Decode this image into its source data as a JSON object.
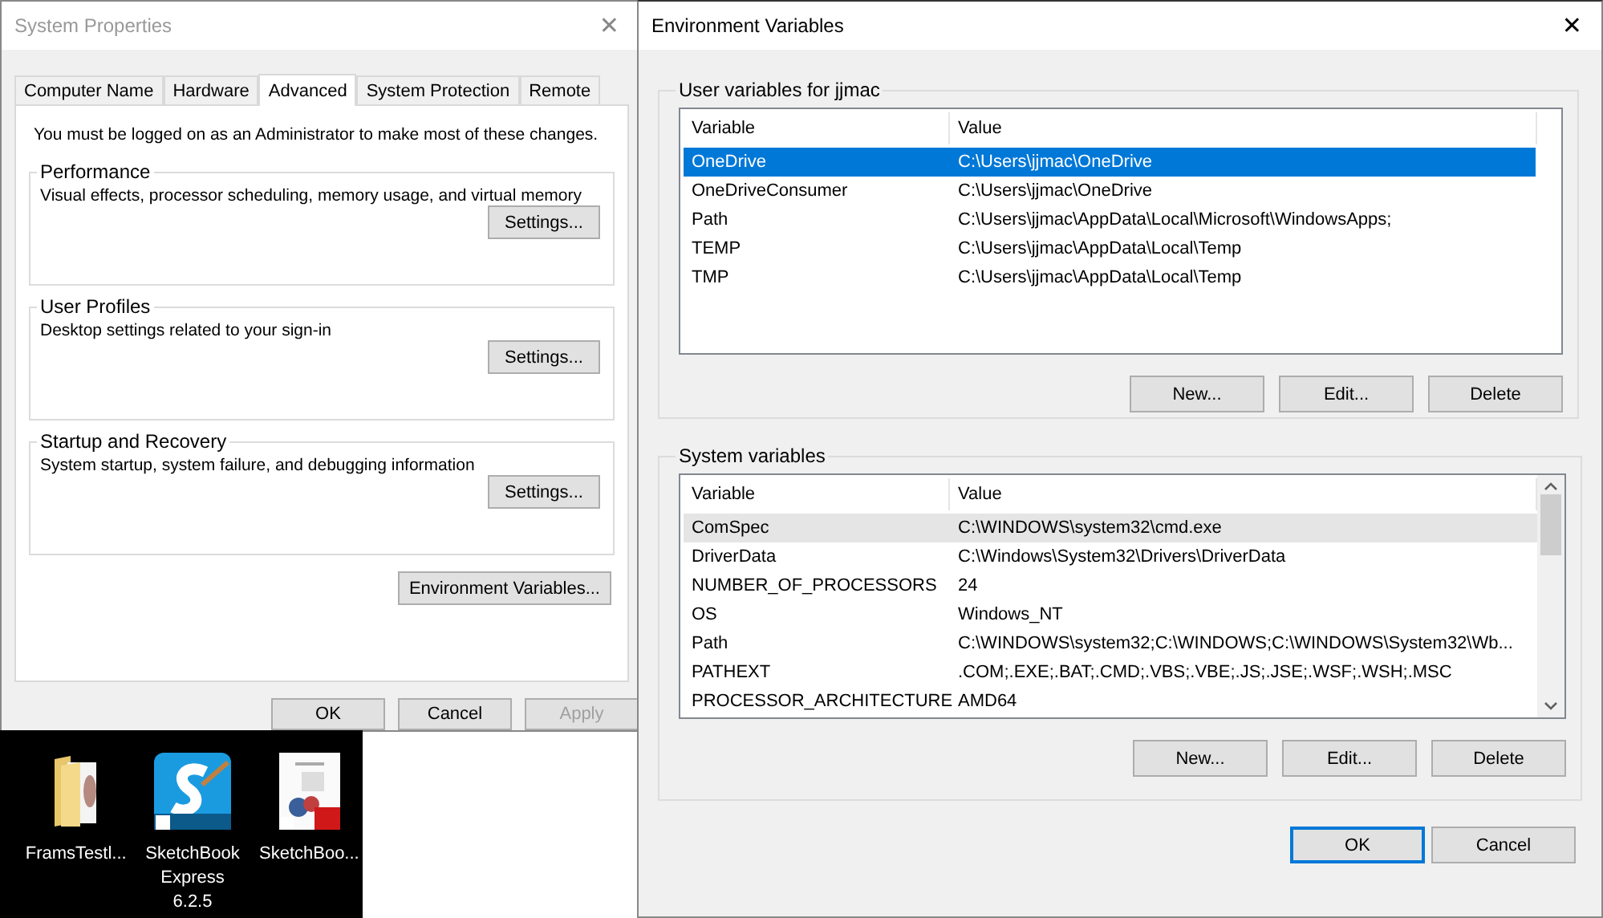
{
  "system_properties": {
    "title": "System Properties",
    "close": "✕",
    "tabs": [
      {
        "label": "Computer Name",
        "selected": false
      },
      {
        "label": "Hardware",
        "selected": false
      },
      {
        "label": "Advanced",
        "selected": true
      },
      {
        "label": "System Protection",
        "selected": false
      },
      {
        "label": "Remote",
        "selected": false
      }
    ],
    "notice": "You must be logged on as an Administrator to make most of these changes.",
    "groups": [
      {
        "title": "Performance",
        "description": "Visual effects, processor scheduling, memory usage, and virtual memory",
        "button": "Settings..."
      },
      {
        "title": "User Profiles",
        "description": "Desktop settings related to your sign-in",
        "button": "Settings..."
      },
      {
        "title": "Startup and Recovery",
        "description": "System startup, system failure, and debugging information",
        "button": "Settings..."
      }
    ],
    "env_button": "Environment Variables...",
    "buttons": [
      {
        "label": "OK",
        "disabled": false
      },
      {
        "label": "Cancel",
        "disabled": false
      },
      {
        "label": "Apply",
        "disabled": true
      }
    ]
  },
  "desktop": {
    "icons": [
      {
        "kind": "folder",
        "label": "FramsTestl..."
      },
      {
        "kind": "sketchbook",
        "label": "SketchBook Express 6.2.5"
      },
      {
        "kind": "pdf",
        "label": "SketchBoo..."
      }
    ]
  },
  "environment_variables": {
    "title": "Environment Variables",
    "close": "✕",
    "sections": [
      {
        "title": "User variables for jjmac",
        "focused": true,
        "scrollable": false,
        "columns": [
          "Variable",
          "Value"
        ],
        "rows": [
          {
            "variable": "OneDrive",
            "value": "C:\\Users\\jjmac\\OneDrive",
            "selected": true
          },
          {
            "variable": "OneDriveConsumer",
            "value": "C:\\Users\\jjmac\\OneDrive",
            "selected": false
          },
          {
            "variable": "Path",
            "value": "C:\\Users\\jjmac\\AppData\\Local\\Microsoft\\WindowsApps;",
            "selected": false
          },
          {
            "variable": "TEMP",
            "value": "C:\\Users\\jjmac\\AppData\\Local\\Temp",
            "selected": false
          },
          {
            "variable": "TMP",
            "value": "C:\\Users\\jjmac\\AppData\\Local\\Temp",
            "selected": false
          }
        ],
        "buttons": [
          "New...",
          "Edit...",
          "Delete"
        ]
      },
      {
        "title": "System variables",
        "focused": false,
        "scrollable": true,
        "columns": [
          "Variable",
          "Value"
        ],
        "rows": [
          {
            "variable": "ComSpec",
            "value": "C:\\WINDOWS\\system32\\cmd.exe",
            "selected": true
          },
          {
            "variable": "DriverData",
            "value": "C:\\Windows\\System32\\Drivers\\DriverData",
            "selected": false
          },
          {
            "variable": "NUMBER_OF_PROCESSORS",
            "value": "24",
            "selected": false
          },
          {
            "variable": "OS",
            "value": "Windows_NT",
            "selected": false
          },
          {
            "variable": "Path",
            "value": "C:\\WINDOWS\\system32;C:\\WINDOWS;C:\\WINDOWS\\System32\\Wb...",
            "selected": false
          },
          {
            "variable": "PATHEXT",
            "value": ".COM;.EXE;.BAT;.CMD;.VBS;.VBE;.JS;.JSE;.WSF;.WSH;.MSC",
            "selected": false
          },
          {
            "variable": "PROCESSOR_ARCHITECTURE",
            "value": "AMD64",
            "selected": false
          }
        ],
        "buttons": [
          "New...",
          "Edit...",
          "Delete"
        ]
      }
    ],
    "buttons": [
      {
        "label": "OK",
        "default": true
      },
      {
        "label": "Cancel",
        "default": false
      }
    ]
  }
}
